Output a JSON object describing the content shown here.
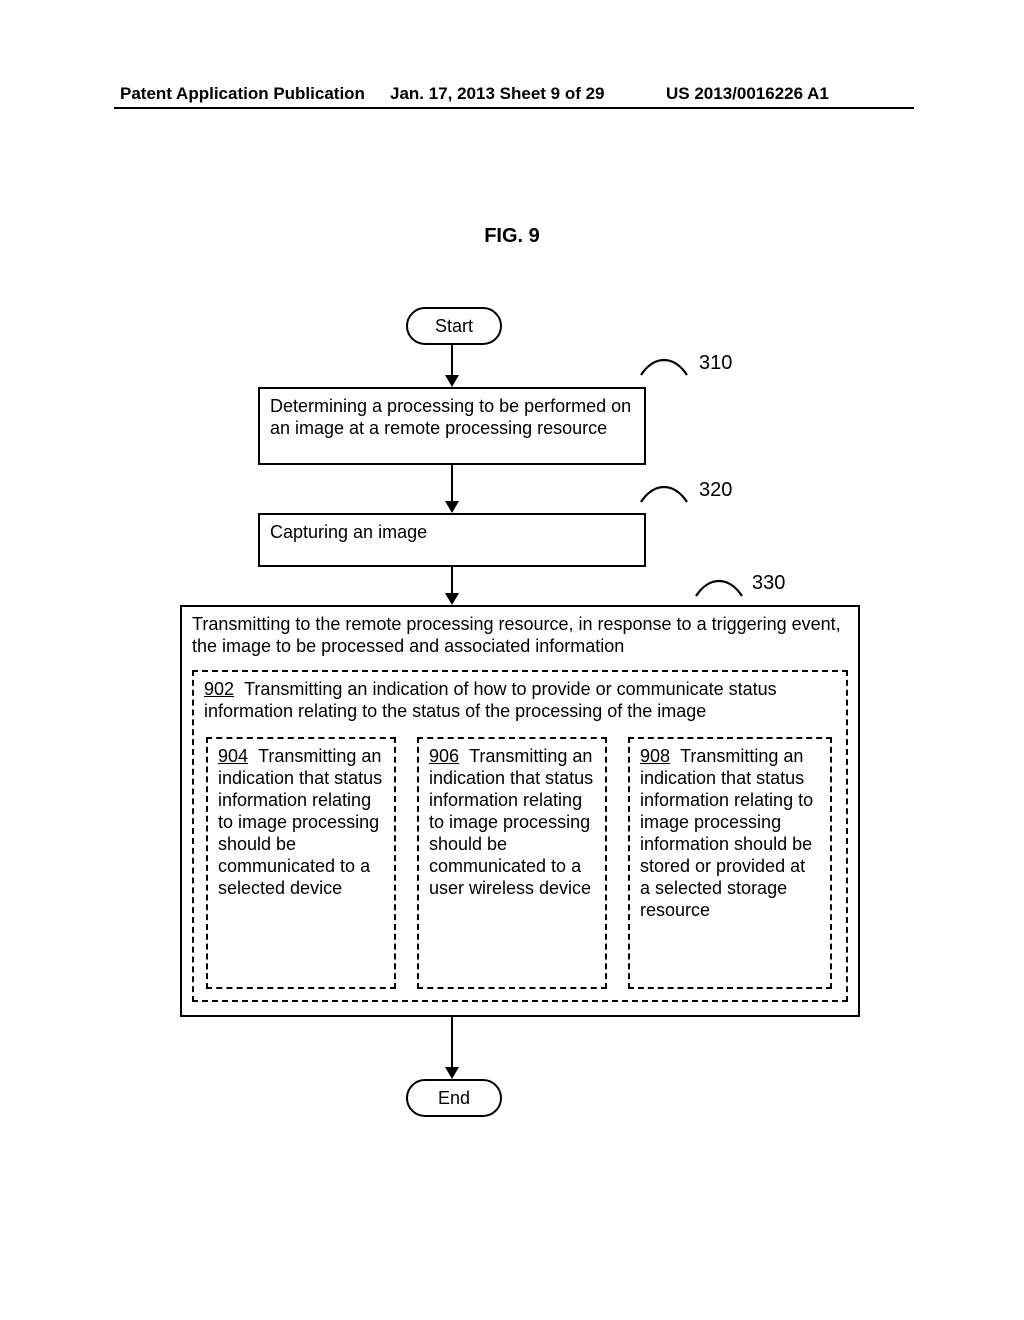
{
  "header": {
    "left": "Patent Application Publication",
    "center": "Jan. 17, 2013  Sheet 9 of 29",
    "right": "US 2013/0016226 A1"
  },
  "figure": {
    "title": "FIG. 9",
    "start": "Start",
    "end": "End",
    "step310": {
      "ref": "310",
      "text": "Determining a processing to be performed on an image at a remote processing resource"
    },
    "step320": {
      "ref": "320",
      "text": "Capturing an image"
    },
    "step330": {
      "ref": "330",
      "text": "Transmitting to the remote processing resource, in response to a triggering event, the image to be processed and associated information"
    },
    "sub902": {
      "ref": "902",
      "text": "Transmitting an indication of how to provide or communicate status information relating to the status of the processing of the image"
    },
    "sub904": {
      "ref": "904",
      "text": "Transmitting an indication that status information relating to image processing should be communicated to a selected device"
    },
    "sub906": {
      "ref": "906",
      "text": "Transmitting an indication that status information relating to image processing should be communicated to a user wireless device"
    },
    "sub908": {
      "ref": "908",
      "text": "Transmitting an indication that status information relating to image processing information should be stored or provided at a selected storage resource"
    }
  }
}
